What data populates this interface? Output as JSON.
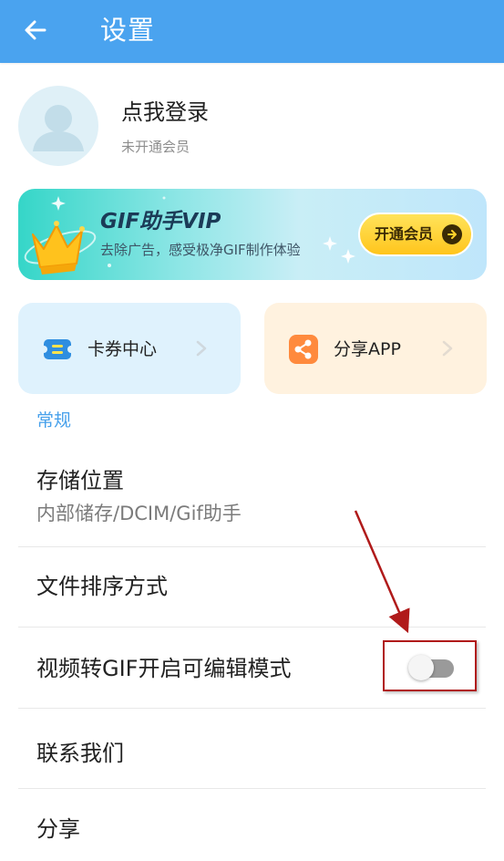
{
  "header": {
    "title": "设置",
    "back_icon": "arrow-left-icon"
  },
  "profile": {
    "name": "点我登录",
    "status": "未开通会员"
  },
  "vip_banner": {
    "title": "GIF助手VIP",
    "subtitle": "去除广告，感受极净GIF制作体验",
    "button_label": "开通会员"
  },
  "quick_actions": [
    {
      "label": "卡券中心",
      "icon": "coupon-icon",
      "color": "#2f8ee0"
    },
    {
      "label": "分享APP",
      "icon": "share-icon",
      "color": "#ff8a3d"
    }
  ],
  "sections": {
    "general": {
      "title": "常规",
      "items": [
        {
          "title": "存储位置",
          "subtitle": "内部储存/DCIM/Gif助手"
        },
        {
          "title": "文件排序方式"
        },
        {
          "title": "视频转GIF开启可编辑模式",
          "toggle": false
        },
        {
          "title": "联系我们"
        },
        {
          "title": "分享"
        }
      ]
    }
  },
  "colors": {
    "primary": "#4aa3ef",
    "section_header": "#46a0eb",
    "annotation": "#b01a1a"
  }
}
